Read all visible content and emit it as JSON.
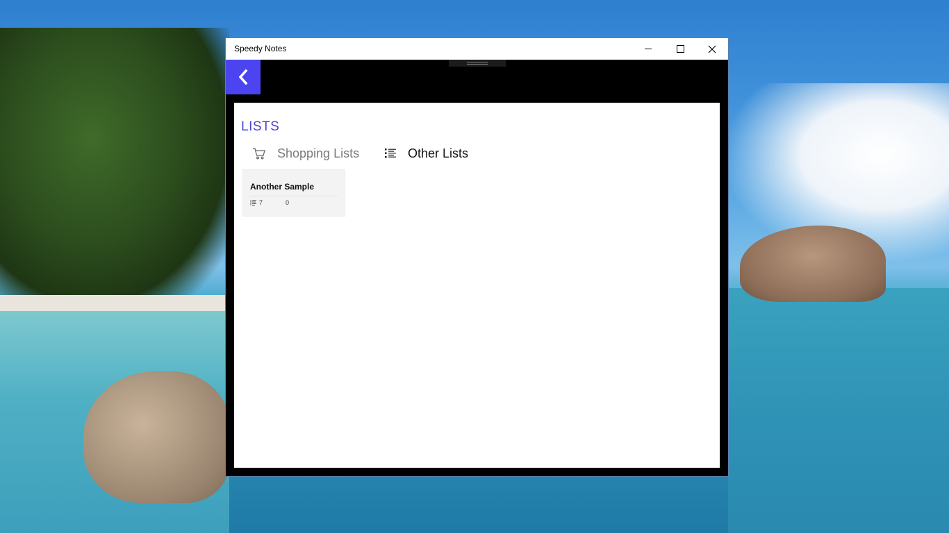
{
  "window": {
    "title": "Speedy Notes"
  },
  "page": {
    "heading": "LISTS"
  },
  "tabs": [
    {
      "label": "Shopping Lists",
      "icon": "cart-icon",
      "active": false
    },
    {
      "label": "Other Lists",
      "icon": "list-icon",
      "active": true
    }
  ],
  "cards": [
    {
      "title": "Another Sample",
      "items_count": "7",
      "checked_count": "0"
    }
  ],
  "colors": {
    "accent": "#4b44f0",
    "heading": "#4b44d0",
    "window_frame": "#000000",
    "content_bg": "#ffffff",
    "card_bg": "#f3f3f3"
  }
}
